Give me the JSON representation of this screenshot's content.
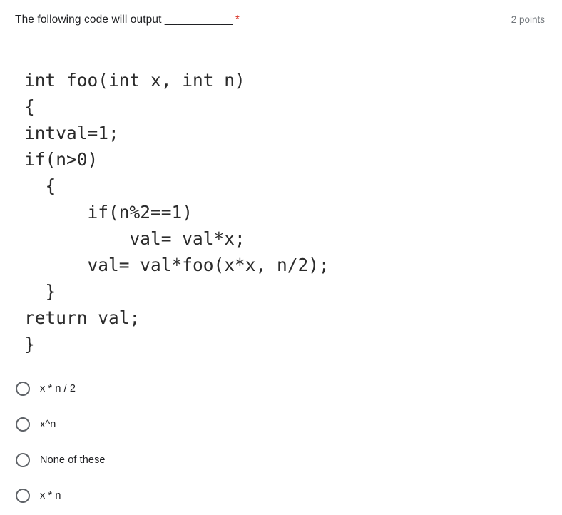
{
  "question": {
    "title": "The following code will output ___________",
    "required_marker": "*",
    "points_label": "2 points"
  },
  "code": {
    "language": "c",
    "lines": [
      "int foo(int x, int n)",
      "{",
      "intval=1;",
      "if(n>0)",
      "  {",
      "      if(n%2==1)",
      "          val= val*x;",
      "      val= val*foo(x*x, n/2);",
      "  }",
      "return val;",
      "}"
    ]
  },
  "options": [
    {
      "label": "x * n / 2",
      "selected": false
    },
    {
      "label": "x^n",
      "selected": false
    },
    {
      "label": "None of these",
      "selected": false
    },
    {
      "label": "x * n",
      "selected": false
    }
  ],
  "colors": {
    "page_background": "#ffffff",
    "text": "#202124",
    "code_text": "#2b2b2b",
    "required_asterisk": "#d93025",
    "points_text": "#70757a",
    "radio_border": "#5f6368"
  }
}
